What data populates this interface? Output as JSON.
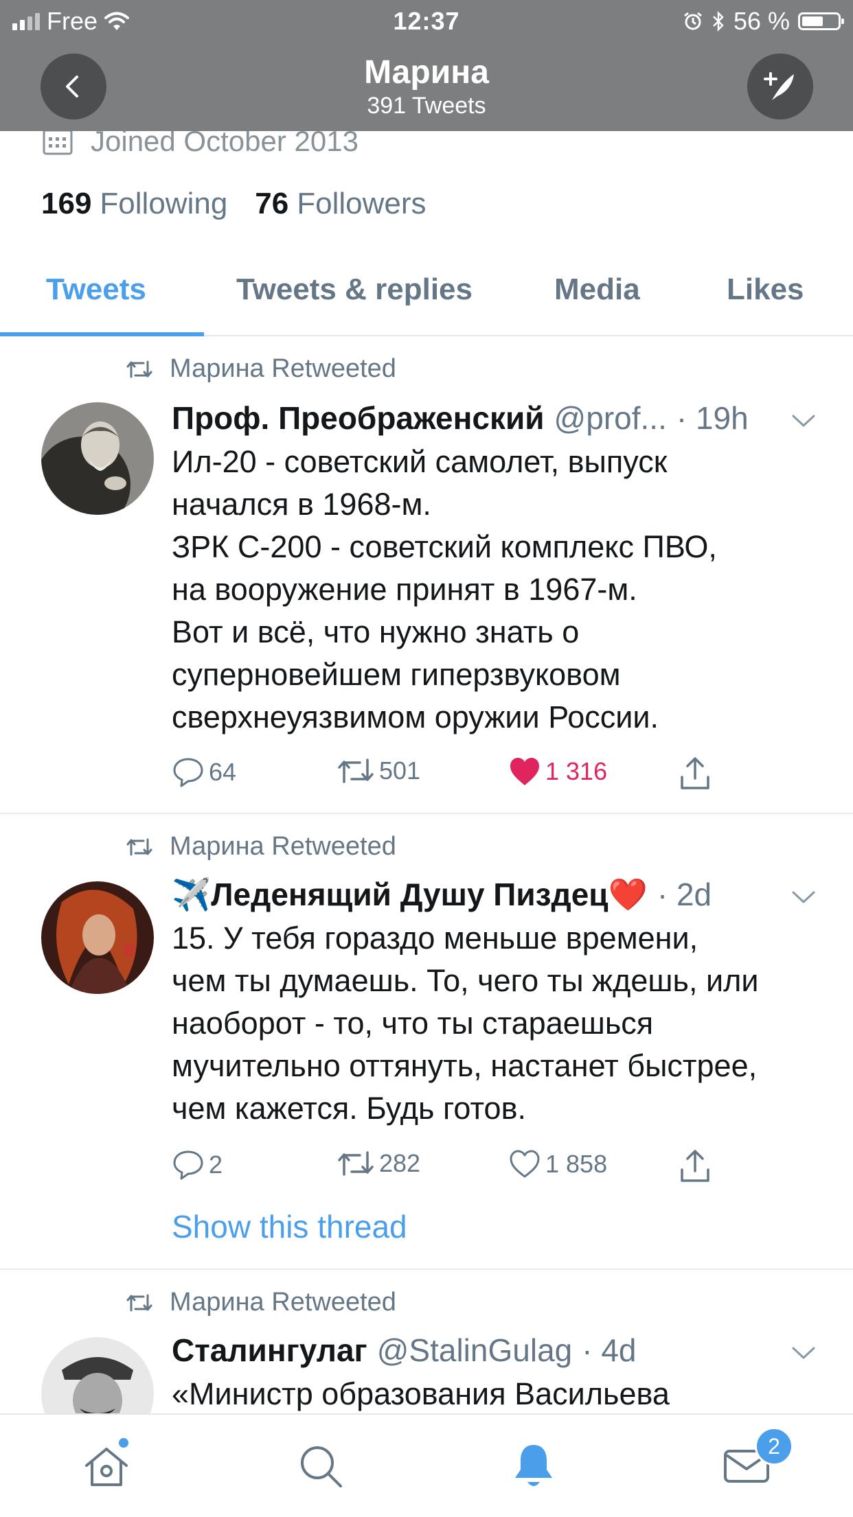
{
  "status_bar": {
    "carrier": "Free",
    "time": "12:37",
    "battery": "56 %"
  },
  "header": {
    "title": "Марина",
    "subtitle": "391 Tweets"
  },
  "profile": {
    "joined": "Joined October 2013",
    "following_count": "169",
    "following_label": "Following",
    "followers_count": "76",
    "followers_label": "Followers"
  },
  "tabs": [
    {
      "label": "Tweets"
    },
    {
      "label": "Tweets & replies"
    },
    {
      "label": "Media"
    },
    {
      "label": "Likes"
    }
  ],
  "tweets": [
    {
      "retweet_label": "Марина Retweeted",
      "display_name": "Проф. Преображенский",
      "handle": "@prof...",
      "time": "· 19h",
      "lines": [
        "Ил-20 - советский самолет, выпуск",
        "начался в 1968-м.",
        "ЗРК С-200 - советский комплекс ПВО,",
        "на вооружение принят в 1967-м.",
        "Вот и всё, что нужно знать о",
        "суперновейшем гиперзвуковом",
        "сверхнеуязвимом оружии России."
      ],
      "replies": "64",
      "retweets": "501",
      "likes": "1 316"
    },
    {
      "retweet_label": "Марина Retweeted",
      "display_name": "✈️Леденящий Душу Пиздец❤️",
      "time": "· 2d",
      "lines": [
        "15. У тебя гораздо меньше времени,",
        "чем ты думаешь. То, чего ты ждешь, или",
        "наоборот - то, что ты стараешься",
        "мучительно оттянуть, настанет быстрее,",
        "чем кажется. Будь готов."
      ],
      "replies": "2",
      "retweets": "282",
      "likes": "1 858",
      "show_thread": "Show this thread"
    },
    {
      "retweet_label": "Марина Retweeted",
      "display_name": "Сталингулаг",
      "handle": "@StalinGulag",
      "time": "· 4d",
      "lines": [
        "«Министр образования Васильева"
      ]
    }
  ],
  "bottom_nav": {
    "messages_badge": "2"
  },
  "colors": {
    "accent": "#4a9eea",
    "like": "#e0245e",
    "header_bg": "#7d7e80"
  }
}
